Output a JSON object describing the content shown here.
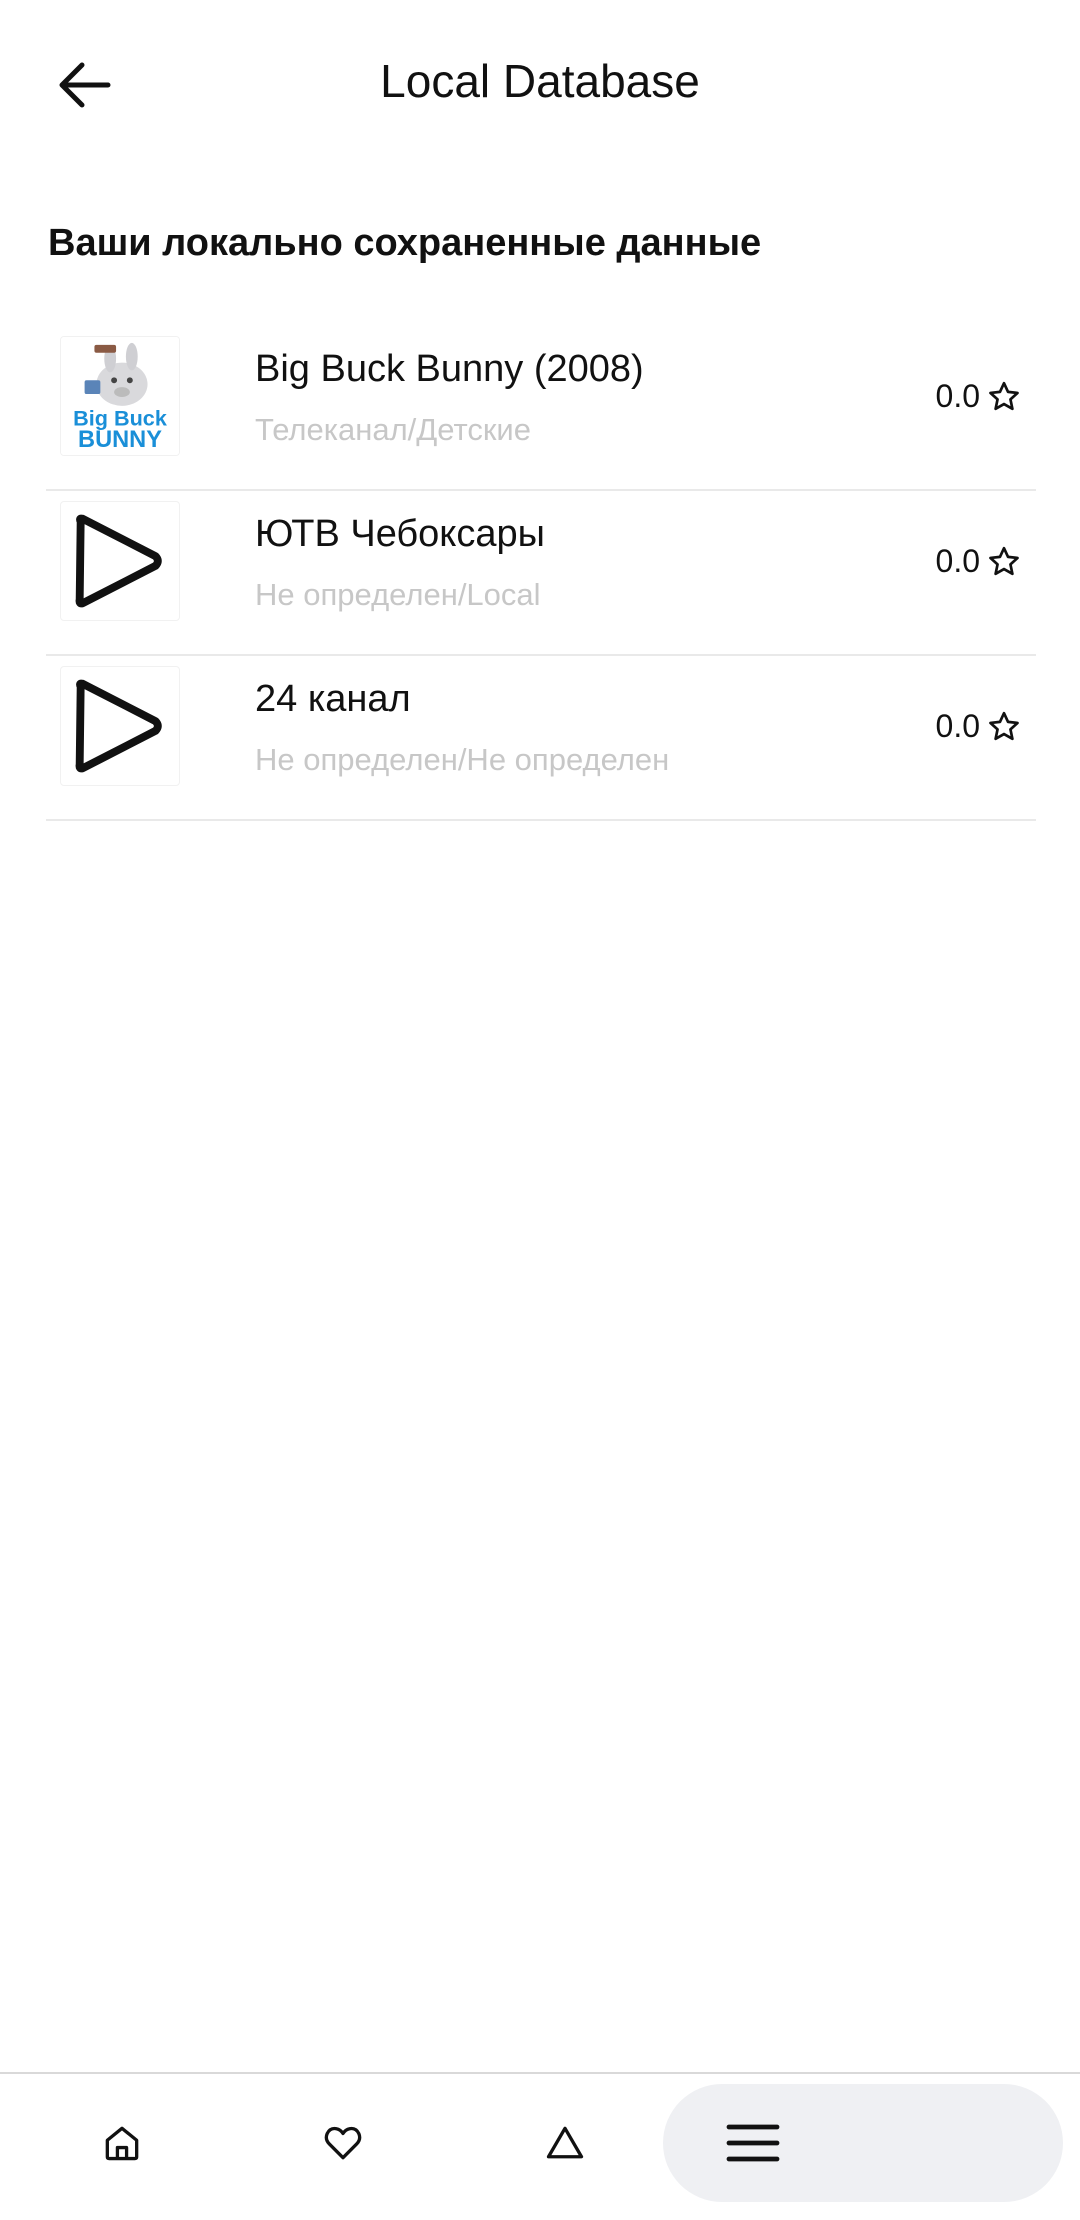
{
  "header": {
    "title": "Local Database"
  },
  "section": {
    "title": "Ваши локально сохраненные данные"
  },
  "items": [
    {
      "title": "Big Buck Bunny (2008)",
      "subtitle": "Телеканал/Детские",
      "rating": "0.0",
      "thumb": "big-buck-bunny-poster",
      "poster_text": [
        "Big Buck",
        "BUNNY"
      ]
    },
    {
      "title": "ЮТВ Чебоксары",
      "subtitle": "Не определен/Local",
      "rating": "0.0",
      "thumb": "play-icon"
    },
    {
      "title": "24 канал",
      "subtitle": "Не определен/Не определен",
      "rating": "0.0",
      "thumb": "play-icon"
    }
  ],
  "bottom_nav": {
    "items": [
      {
        "icon": "home-icon"
      },
      {
        "icon": "heart-icon"
      },
      {
        "icon": "triangle-icon"
      },
      {
        "icon": "menu-icon",
        "active": true
      }
    ]
  },
  "colors": {
    "subtitle": "#c7c7c7",
    "active_nav_bg": "#eff0f3",
    "poster_blue": "#1a8fd8"
  }
}
